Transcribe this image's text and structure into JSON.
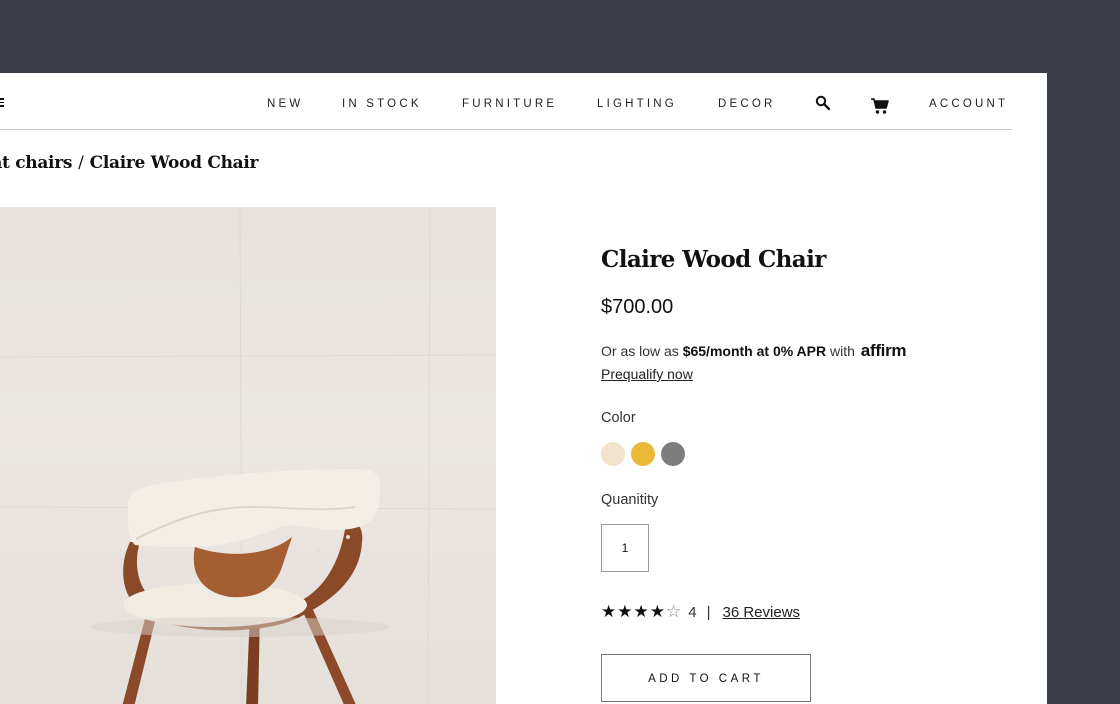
{
  "nav": {
    "links": [
      "NEW",
      "IN STOCK",
      "FURNITURE",
      "LIGHTING",
      "DECOR"
    ],
    "account": "ACCOUNT",
    "icons": [
      "search-icon",
      "cart-icon",
      "menu-icon"
    ]
  },
  "breadcrumb": {
    "parent": "nt chairs",
    "separator": "/",
    "current": "Claire Wood Chair"
  },
  "product": {
    "title": "Claire Wood Chair",
    "price": "$700.00",
    "finance_prefix": "Or as low as",
    "finance_offer": "$65/month at 0% APR",
    "finance_with": "with",
    "finance_brand": "affirm",
    "prequalify": "Prequalify now",
    "color_label": "Color",
    "colors": [
      "#f3e3cc",
      "#eab938",
      "#7d7d7d"
    ],
    "quantity_label": "Quanitity",
    "quantity": "1",
    "rating": 4,
    "rating_max": 5,
    "rating_text": "4",
    "rating_separator": "|",
    "reviews": "36 Reviews",
    "add_to_cart": "ADD TO CART"
  },
  "colors": {
    "page_bg": "#3a3d48",
    "panel_bg": "#ffffff",
    "text": "#111111"
  }
}
